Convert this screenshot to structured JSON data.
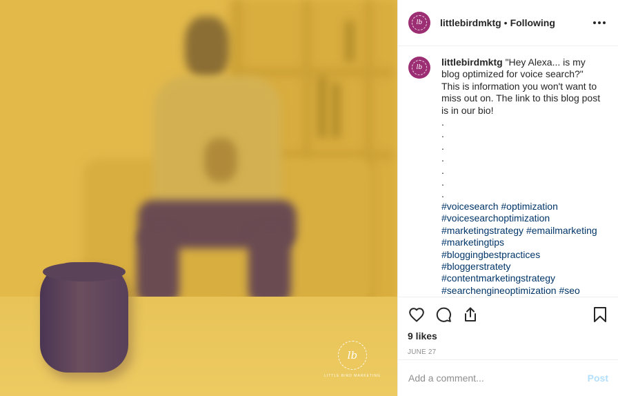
{
  "post": {
    "username": "littlebirdmktg",
    "separator": "•",
    "follow_status": "Following",
    "caption": "\"Hey Alexa... is my blog optimized for voice search?\" This is information you won't want to miss out on. The link to this blog post is in our bio!",
    "dots": [
      ".",
      ".",
      ".",
      ".",
      ".",
      ".",
      "."
    ],
    "hashtags": [
      "#voicesearch",
      "#optimization",
      "#voicesearchoptimization",
      "#marketingstrategy",
      "#emailmarketing",
      "#marketingtips",
      "#bloggingbestpractices",
      "#bloggerstratety",
      "#contentmarketingstrategy",
      "#searchengineoptimization",
      "#seo"
    ],
    "likes": "9 likes",
    "date": "JUNE 27"
  },
  "image": {
    "watermark_text": "LITTLE BIRD MARKETING",
    "watermark_monogram": "lb"
  },
  "comment": {
    "placeholder": "Add a comment...",
    "post_label": "Post"
  },
  "icons": {
    "more": "more-options-icon",
    "like": "heart-icon",
    "comment": "comment-icon",
    "share": "share-icon",
    "save": "bookmark-icon"
  },
  "colors": {
    "photo_tint": "#e3b94a",
    "avatar": "#9c2e73",
    "hashtag": "#003569",
    "post_disabled": "#b2dffc",
    "muted": "#8e8e8e"
  }
}
